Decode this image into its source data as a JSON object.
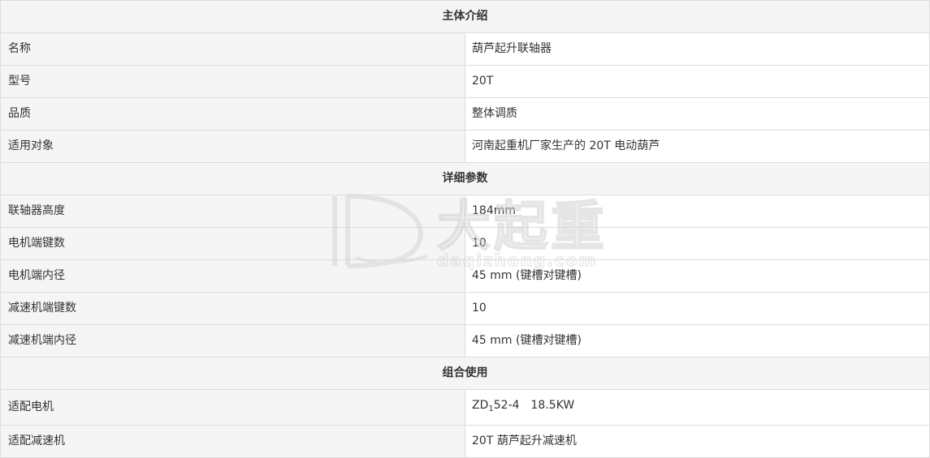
{
  "sections": [
    {
      "title": "主体介绍",
      "rows": [
        {
          "label": "名称",
          "value": "葫芦起升联轴器"
        },
        {
          "label": "型号",
          "value": "20T"
        },
        {
          "label": "品质",
          "value": "整体调质"
        },
        {
          "label": "适用对象",
          "value": "河南起重机厂家生产的 20T 电动葫芦"
        }
      ]
    },
    {
      "title": "详细参数",
      "rows": [
        {
          "label": "联轴器高度",
          "value": "184mm"
        },
        {
          "label": "电机端键数",
          "value": "10"
        },
        {
          "label": "电机端内径",
          "value": "45 mm (键槽对键槽)"
        },
        {
          "label": "减速机端键数",
          "value": "10"
        },
        {
          "label": "减速机端内径",
          "value": "45 mm (键槽对键槽)"
        }
      ]
    },
    {
      "title": "组合使用",
      "rows": [
        {
          "label": "适配电机",
          "value_prefix": "ZD",
          "value_sub": "1",
          "value": "52-4　18.5KW"
        },
        {
          "label": "适配减速机",
          "value": "20T 葫芦起升减速机"
        }
      ]
    }
  ],
  "watermark": {
    "brand": "大起重",
    "domain": "daqizhong.com",
    "color": "#c8c8c8"
  }
}
